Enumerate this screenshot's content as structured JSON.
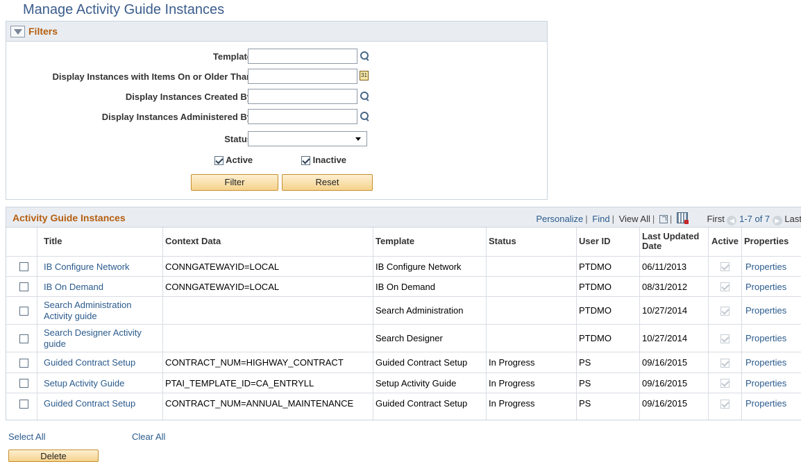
{
  "page_title": "Manage Activity Guide Instances",
  "filters": {
    "title": "Filters",
    "template_label": "Template",
    "template_value": "",
    "display_older_label": "Display Instances with Items On or Older Than",
    "display_older_value": "",
    "calendar_text": "31",
    "created_by_label": "Display Instances Created By",
    "created_by_value": "",
    "administered_by_label": "Display Instances Administered By",
    "administered_by_value": "",
    "status_label": "Status",
    "status_value": "",
    "active_label": "Active",
    "inactive_label": "Inactive",
    "filter_button": "Filter",
    "reset_button": "Reset"
  },
  "grid": {
    "title": "Activity Guide Instances",
    "personalize": "Personalize",
    "find": "Find",
    "view_all": "View All",
    "first": "First",
    "range": "1-7 of 7",
    "last": "Last",
    "columns": {
      "title": "Title",
      "context": "Context Data",
      "template": "Template",
      "status": "Status",
      "user": "User ID",
      "updated": "Last Updated Date",
      "active": "Active",
      "properties": "Properties"
    },
    "rows": [
      {
        "title": "IB Configure Network",
        "context": "CONNGATEWAYID=LOCAL",
        "template": "IB Configure Network",
        "status": "",
        "user": "PTDMO",
        "updated": "06/11/2013",
        "properties": "Properties"
      },
      {
        "title": "IB On Demand",
        "context": "CONNGATEWAYID=LOCAL",
        "template": "IB On Demand",
        "status": "",
        "user": "PTDMO",
        "updated": "08/31/2012",
        "properties": "Properties"
      },
      {
        "title": "Search Administration Activity guide",
        "context": "",
        "template": "Search Administration",
        "status": "",
        "user": "PTDMO",
        "updated": "10/27/2014",
        "properties": "Properties"
      },
      {
        "title": "Search Designer Activity guide",
        "context": "",
        "template": "Search Designer",
        "status": "",
        "user": "PTDMO",
        "updated": "10/27/2014",
        "properties": "Properties"
      },
      {
        "title": "Guided Contract Setup",
        "context": "CONTRACT_NUM=HIGHWAY_CONTRACT",
        "template": "Guided Contract Setup",
        "status": "In Progress",
        "user": "PS",
        "updated": "09/16/2015",
        "properties": "Properties"
      },
      {
        "title": "Setup Activity Guide",
        "context": "PTAI_TEMPLATE_ID=CA_ENTRYLL",
        "template": "Setup Activity Guide",
        "status": "In Progress",
        "user": "PS",
        "updated": "09/16/2015",
        "properties": "Properties"
      },
      {
        "title": "Guided Contract Setup",
        "context": "CONTRACT_NUM=ANNUAL_MAINTENANCE",
        "template": "Guided Contract Setup",
        "status": "In Progress",
        "user": "PS",
        "updated": "09/16/2015",
        "properties": "Properties"
      }
    ]
  },
  "actions": {
    "select_all": "Select All",
    "clear_all": "Clear All",
    "delete": "Delete"
  }
}
